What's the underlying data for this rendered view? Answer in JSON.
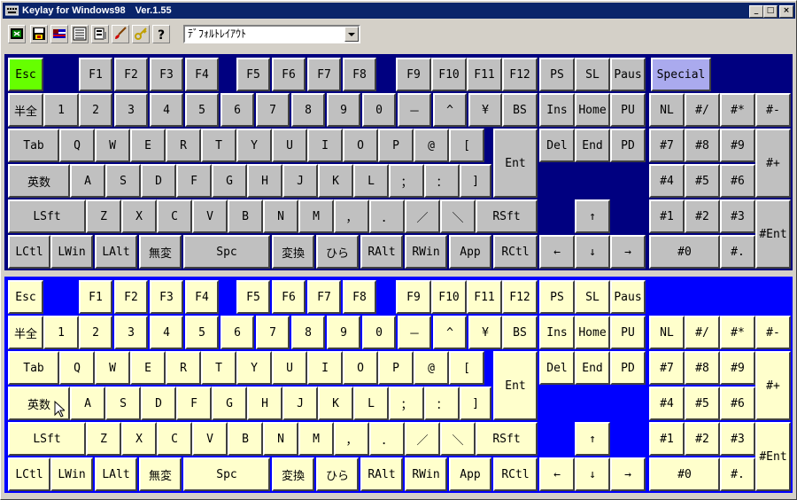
{
  "window": {
    "title": "Keylay for Windows98　Ver.1.55",
    "controls": [
      "_",
      "□",
      "×"
    ]
  },
  "toolbar": {
    "tools": [
      "exit-icon",
      "save-icon",
      "flag-icon",
      "list-icon",
      "keyboard-settings-icon",
      "brush-icon",
      "key-icon",
      "help-icon"
    ],
    "layout_select_value": "ﾃﾞﾌｫﾙﾄﾚｲｱｳﾄ"
  },
  "keyboard": {
    "keys": [
      "Esc",
      "F1",
      "F2",
      "F3",
      "F4",
      "F5",
      "F6",
      "F7",
      "F8",
      "F9",
      "F10",
      "F11",
      "F12",
      "PS",
      "SL",
      "Paus",
      "半全",
      "1",
      "2",
      "3",
      "4",
      "5",
      "6",
      "7",
      "8",
      "9",
      "0",
      "－",
      "^",
      "¥",
      "BS",
      "Ins",
      "Home",
      "PU",
      "NL",
      "#/",
      "#*",
      "#-",
      "Tab",
      "Q",
      "W",
      "E",
      "R",
      "T",
      "Y",
      "U",
      "I",
      "O",
      "P",
      "@",
      "[",
      "Ent",
      "Del",
      "End",
      "PD",
      "#7",
      "#8",
      "#9",
      "#+",
      "英数",
      "A",
      "S",
      "D",
      "F",
      "G",
      "H",
      "J",
      "K",
      "L",
      "；",
      "：",
      "]",
      "#4",
      "#5",
      "#6",
      "LSft",
      "Z",
      "X",
      "C",
      "V",
      "B",
      "N",
      "M",
      "，",
      "．",
      "／",
      "＼",
      "RSft",
      "↑",
      "#1",
      "#2",
      "#3",
      "#Ent",
      "LCtl",
      "LWin",
      "LAlt",
      "無変",
      "Spc",
      "変換",
      "ひら",
      "RAlt",
      "RWin",
      "App",
      "RCtl",
      "←",
      "↓",
      "→",
      "#0",
      "#."
    ],
    "special_label": "Special"
  },
  "colors": {
    "titlebar": "#0a246a",
    "top_panel_bg": "#000080",
    "bottom_panel_bg": "#0000ff",
    "top_key": "#c0c0c0",
    "bottom_key": "#ffffcc",
    "esc_active": "#66ff00",
    "special_key": "#aaaaee"
  }
}
